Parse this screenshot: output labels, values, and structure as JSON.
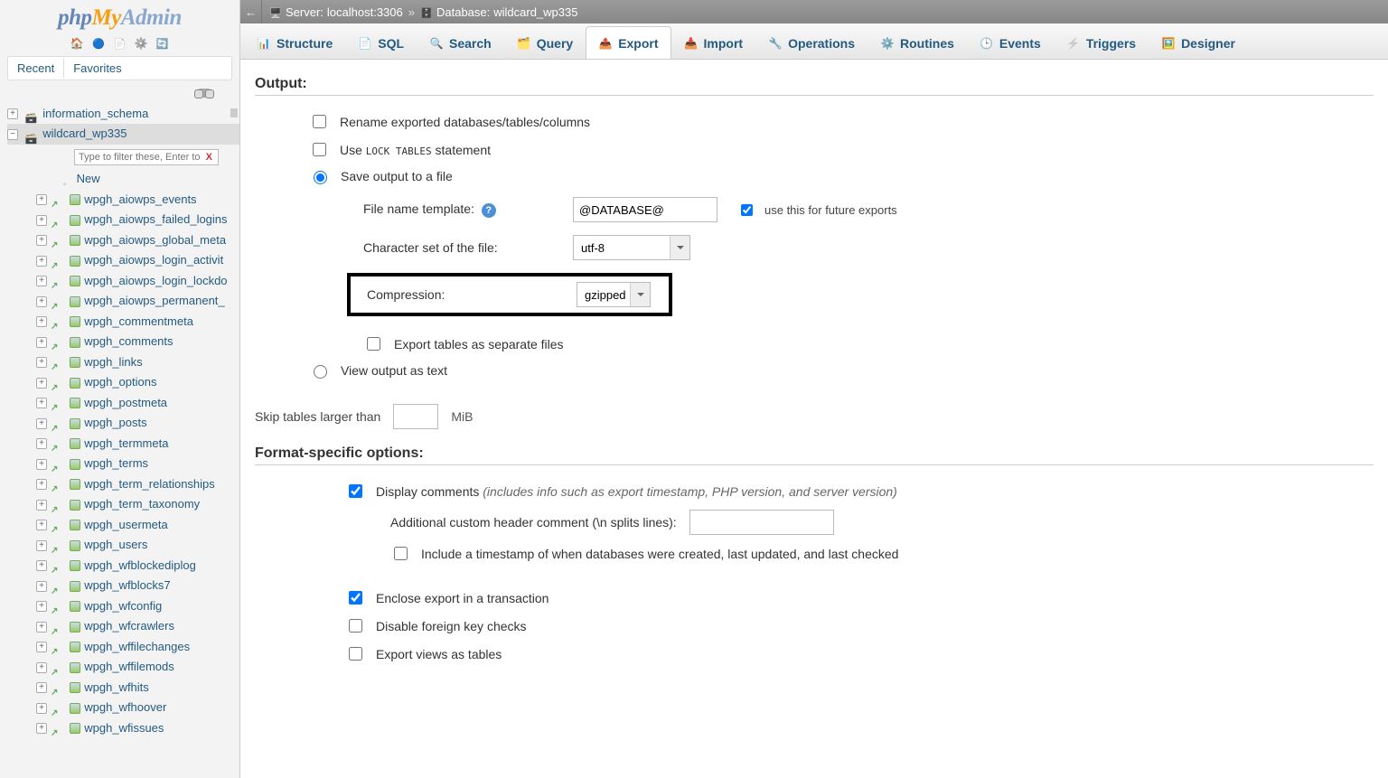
{
  "logo": {
    "part1": "php",
    "part2": "My",
    "part3": "Admin"
  },
  "sidebar": {
    "recent": "Recent",
    "favorites": "Favorites",
    "filter_placeholder": "Type to filter these, Enter to search a",
    "new_label": "New",
    "databases": [
      {
        "name": "information_schema",
        "expanded": false
      },
      {
        "name": "wildcard_wp335",
        "expanded": true
      }
    ],
    "tables": [
      "wpgh_aiowps_events",
      "wpgh_aiowps_failed_logins",
      "wpgh_aiowps_global_meta",
      "wpgh_aiowps_login_activit",
      "wpgh_aiowps_login_lockdo",
      "wpgh_aiowps_permanent_",
      "wpgh_commentmeta",
      "wpgh_comments",
      "wpgh_links",
      "wpgh_options",
      "wpgh_postmeta",
      "wpgh_posts",
      "wpgh_termmeta",
      "wpgh_terms",
      "wpgh_term_relationships",
      "wpgh_term_taxonomy",
      "wpgh_usermeta",
      "wpgh_users",
      "wpgh_wfblockediplog",
      "wpgh_wfblocks7",
      "wpgh_wfconfig",
      "wpgh_wfcrawlers",
      "wpgh_wffilechanges",
      "wpgh_wffilemods",
      "wpgh_wfhits",
      "wpgh_wfhoover",
      "wpgh_wfissues"
    ]
  },
  "breadcrumb": {
    "server_label": "Server:",
    "server_value": "localhost:3306",
    "database_label": "Database:",
    "database_value": "wildcard_wp335"
  },
  "tabs": [
    {
      "icon": "ti-structure",
      "label": "Structure"
    },
    {
      "icon": "ti-sql",
      "label": "SQL"
    },
    {
      "icon": "ti-search",
      "label": "Search"
    },
    {
      "icon": "ti-query",
      "label": "Query"
    },
    {
      "icon": "ti-export",
      "label": "Export",
      "active": true
    },
    {
      "icon": "ti-import",
      "label": "Import"
    },
    {
      "icon": "ti-operations",
      "label": "Operations"
    },
    {
      "icon": "ti-routines",
      "label": "Routines"
    },
    {
      "icon": "ti-events",
      "label": "Events"
    },
    {
      "icon": "ti-triggers",
      "label": "Triggers"
    },
    {
      "icon": "ti-designer",
      "label": "Designer"
    }
  ],
  "export": {
    "output_title": "Output:",
    "opt_rename": "Rename exported databases/tables/columns",
    "opt_lock_prefix": "Use ",
    "opt_lock_mono": "LOCK TABLES",
    "opt_lock_suffix": " statement",
    "opt_save": "Save output to a file",
    "fn_label": "File name template:",
    "fn_value": "@DATABASE@",
    "future_label": "use this for future exports",
    "charset_label": "Character set of the file:",
    "charset_value": "utf-8",
    "compression_label": "Compression:",
    "compression_value": "gzipped",
    "separate_files": "Export tables as separate files",
    "view_text": "View output as text",
    "skip_label": "Skip tables larger than",
    "skip_unit": "MiB",
    "fsopt_title": "Format-specific options:",
    "disp_comments_label": "Display comments ",
    "disp_comments_hint": "(includes info such as export timestamp, PHP version, and server version)",
    "addl_header_label": "Additional custom header comment (\\n splits lines):",
    "include_ts": "Include a timestamp of when databases were created, last updated, and last checked",
    "enclose_tx": "Enclose export in a transaction",
    "disable_fk": "Disable foreign key checks",
    "export_views": "Export views as tables"
  }
}
